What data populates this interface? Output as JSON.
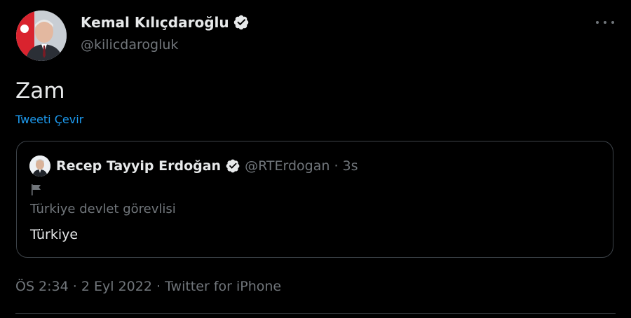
{
  "tweet": {
    "author": {
      "name": "Kemal Kılıçdaroğlu",
      "handle": "@kilicdarogluk",
      "avatar_icon": "profile-photo"
    },
    "text": "Zam",
    "translate_label": "Tweeti Çevir",
    "more_icon": "more-horizontal-icon",
    "quote": {
      "author_name": "Recep Tayyip Erdoğan",
      "author_handle": "@RTErdogan",
      "separator": "·",
      "time": "3s",
      "flag_icon": "flag-icon",
      "label": "Türkiye devlet görevlisi",
      "text": "Türkiye"
    },
    "meta": {
      "time": "ÖS 2:34",
      "sep1": "·",
      "date": "2 Eyl 2022",
      "sep2": "·",
      "source": "Twitter for iPhone"
    }
  },
  "colors": {
    "background": "#000000",
    "primary_text": "#e7e9ea",
    "secondary_text": "#71767b",
    "link": "#1d9bf0",
    "border": "#3d4349"
  }
}
